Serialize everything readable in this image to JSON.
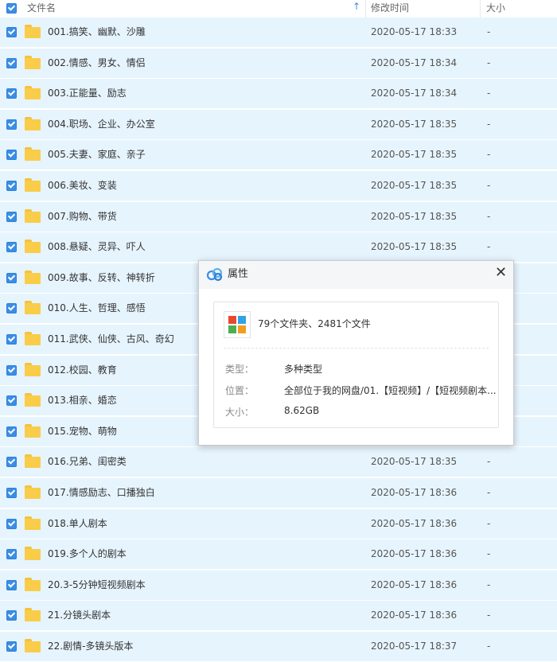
{
  "header": {
    "col_name": "文件名",
    "col_modified": "修改时间",
    "col_size": "大小",
    "sort_indicator": "↑"
  },
  "files": [
    {
      "name": "001.搞笑、幽默、沙雕",
      "modified": "2020-05-17 18:33",
      "size": "-"
    },
    {
      "name": "002.情感、男女、情侣",
      "modified": "2020-05-17 18:34",
      "size": "-"
    },
    {
      "name": "003.正能量、励志",
      "modified": "2020-05-17 18:34",
      "size": "-"
    },
    {
      "name": "004.职场、企业、办公室",
      "modified": "2020-05-17 18:35",
      "size": "-"
    },
    {
      "name": "005.夫妻、家庭、亲子",
      "modified": "2020-05-17 18:35",
      "size": "-"
    },
    {
      "name": "006.美妆、变装",
      "modified": "2020-05-17 18:35",
      "size": "-"
    },
    {
      "name": "007.购物、带货",
      "modified": "2020-05-17 18:35",
      "size": "-"
    },
    {
      "name": "008.悬疑、灵异、吓人",
      "modified": "2020-05-17 18:35",
      "size": "-"
    },
    {
      "name": "009.故事、反转、神转折",
      "modified": "",
      "size": ""
    },
    {
      "name": "010.人生、哲理、感悟",
      "modified": "",
      "size": ""
    },
    {
      "name": "011.武侠、仙侠、古风、奇幻",
      "modified": "",
      "size": ""
    },
    {
      "name": "012.校园、教育",
      "modified": "",
      "size": ""
    },
    {
      "name": "013.相亲、婚恋",
      "modified": "",
      "size": ""
    },
    {
      "name": "015.宠物、萌物",
      "modified": "",
      "size": ""
    },
    {
      "name": "016.兄弟、闺密类",
      "modified": "2020-05-17 18:35",
      "size": "-"
    },
    {
      "name": "017.情感励志、口播独白",
      "modified": "2020-05-17 18:36",
      "size": "-"
    },
    {
      "name": "018.单人剧本",
      "modified": "2020-05-17 18:36",
      "size": "-"
    },
    {
      "name": "019.多个人的剧本",
      "modified": "2020-05-17 18:36",
      "size": "-"
    },
    {
      "name": "20.3-5分钟短视频剧本",
      "modified": "2020-05-17 18:36",
      "size": "-"
    },
    {
      "name": "21.分镜头剧本",
      "modified": "2020-05-17 18:36",
      "size": "-"
    },
    {
      "name": "22.剧情-多镜头版本",
      "modified": "2020-05-17 18:37",
      "size": "-"
    }
  ],
  "dialog": {
    "title": "属性",
    "close_symbol": "✕",
    "summary": "79个文件夹、2481个文件",
    "type_label": "类型：",
    "type_value": "多种类型",
    "location_label": "位置：",
    "location_value": "全部位于我的网盘/01.【短视频】/【短视频剧本...",
    "size_label": "大小：",
    "size_value": "8.62GB"
  },
  "colors": {
    "row_selected": "#e6f4fd",
    "checkbox": "#3a8ee6",
    "folder": "#f9cc4a"
  }
}
